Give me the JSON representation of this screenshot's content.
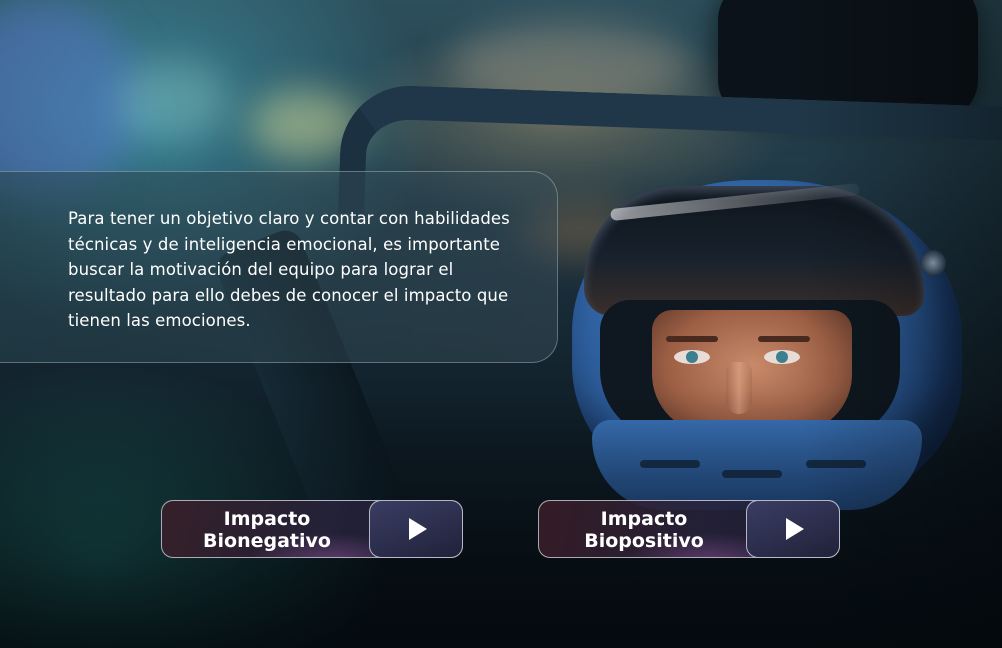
{
  "panel": {
    "text": "Para tener un objetivo claro y contar con habilidades técnicas y de inteligencia emocional, es importante buscar la motivación del equipo para lograr el resultado para ello debes de conocer el impacto que tienen las emociones."
  },
  "buttons": [
    {
      "label_line1": "Impacto",
      "label_line2": "Bionegativo",
      "icon": "play-icon"
    },
    {
      "label_line1": "Impacto",
      "label_line2": "Biopositivo",
      "icon": "play-icon"
    }
  ],
  "colors": {
    "button_play_bg": "#2b2e4c",
    "panel_border": "#d2e1eb",
    "text": "#ffffff"
  }
}
